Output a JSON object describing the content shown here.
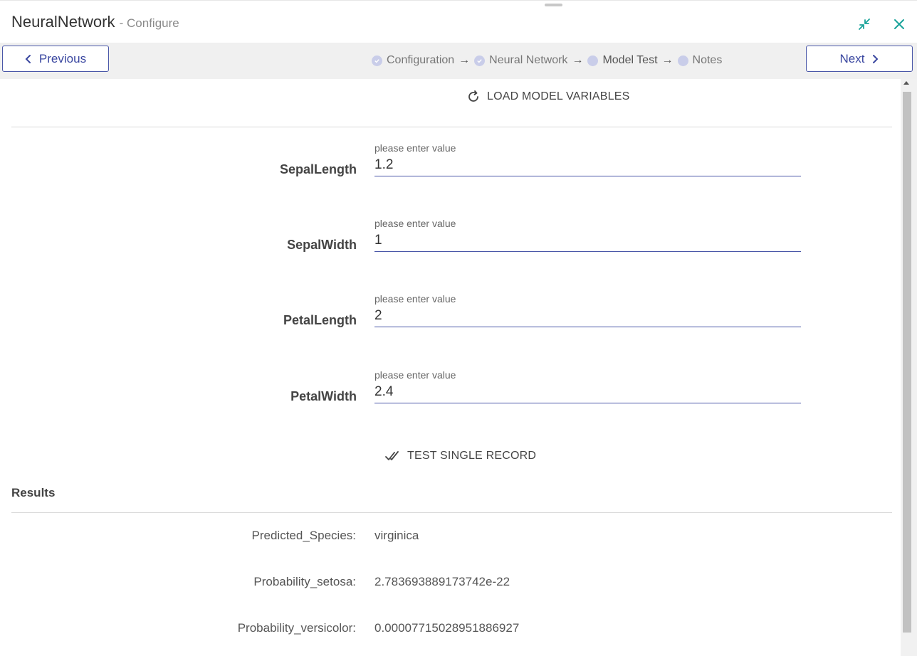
{
  "window": {
    "title": "NeuralNetwork",
    "subtitle": "- Configure"
  },
  "nav": {
    "previous_label": "Previous",
    "next_label": "Next",
    "steps": [
      {
        "label": "Configuration",
        "state": "done"
      },
      {
        "label": "Neural Network",
        "state": "done"
      },
      {
        "label": "Model Test",
        "state": "active"
      },
      {
        "label": "Notes",
        "state": "pending"
      }
    ],
    "arrow": "→"
  },
  "model_test": {
    "load_label": "LOAD MODEL VARIABLES",
    "fields": [
      {
        "label": "SepalLength",
        "hint": "please enter value",
        "value": "1.2"
      },
      {
        "label": "SepalWidth",
        "hint": "please enter value",
        "value": "1"
      },
      {
        "label": "PetalLength",
        "hint": "please enter value",
        "value": "2"
      },
      {
        "label": "PetalWidth",
        "hint": "please enter value",
        "value": "2.4"
      }
    ],
    "test_label": "TEST SINGLE RECORD"
  },
  "results": {
    "title": "Results",
    "rows": [
      {
        "label": "Predicted_Species:",
        "value": "virginica"
      },
      {
        "label": "Probability_setosa:",
        "value": "2.783693889173742e-22"
      },
      {
        "label": "Probability_versicolor:",
        "value": "0.00007715028951886927"
      }
    ]
  },
  "colors": {
    "accent": "#3f51b5",
    "teal_icon": "#1aa39a",
    "step_dot": "#c9cde9"
  },
  "icons": {
    "minimize": "collapse-arrows-icon",
    "close": "close-icon",
    "previous": "chevron-left-icon",
    "next": "chevron-right-icon",
    "load": "refresh-icon",
    "test": "double-check-icon",
    "step_done": "check-circle-icon"
  }
}
